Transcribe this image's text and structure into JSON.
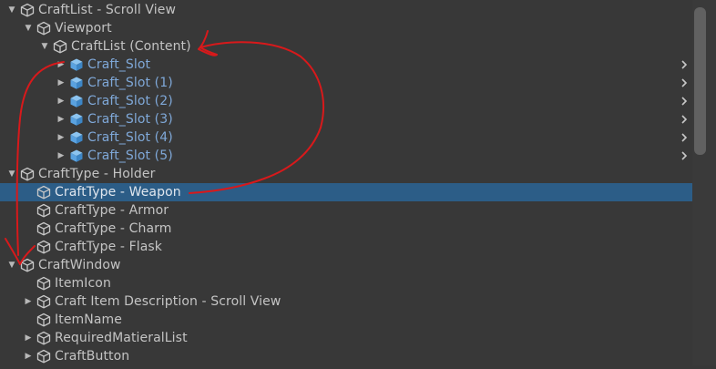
{
  "rows": [
    {
      "label": "CraftList - Scroll View",
      "arrow": "down",
      "kind": "go",
      "selected": false,
      "child_arrow": false
    },
    {
      "label": "Viewport",
      "arrow": "down",
      "kind": "go",
      "selected": false,
      "child_arrow": false
    },
    {
      "label": "CraftList (Content)",
      "arrow": "down",
      "kind": "go",
      "selected": false,
      "child_arrow": false
    },
    {
      "label": "Craft_Slot",
      "arrow": "right",
      "kind": "prefab",
      "selected": false,
      "child_arrow": true
    },
    {
      "label": "Craft_Slot (1)",
      "arrow": "right",
      "kind": "prefab",
      "selected": false,
      "child_arrow": true
    },
    {
      "label": "Craft_Slot (2)",
      "arrow": "right",
      "kind": "prefab",
      "selected": false,
      "child_arrow": true
    },
    {
      "label": "Craft_Slot (3)",
      "arrow": "right",
      "kind": "prefab",
      "selected": false,
      "child_arrow": true
    },
    {
      "label": "Craft_Slot (4)",
      "arrow": "right",
      "kind": "prefab",
      "selected": false,
      "child_arrow": true
    },
    {
      "label": "Craft_Slot (5)",
      "arrow": "right",
      "kind": "prefab",
      "selected": false,
      "child_arrow": true
    },
    {
      "label": "CraftType - Holder",
      "arrow": "down",
      "kind": "go",
      "selected": false,
      "child_arrow": false
    },
    {
      "label": "CraftType - Weapon",
      "arrow": "none",
      "kind": "go",
      "selected": true,
      "child_arrow": false
    },
    {
      "label": "CraftType - Armor",
      "arrow": "none",
      "kind": "go",
      "selected": false,
      "child_arrow": false
    },
    {
      "label": "CraftType - Charm",
      "arrow": "none",
      "kind": "go",
      "selected": false,
      "child_arrow": false
    },
    {
      "label": "CraftType - Flask",
      "arrow": "none",
      "kind": "go",
      "selected": false,
      "child_arrow": false
    },
    {
      "label": "CraftWindow",
      "arrow": "down",
      "kind": "go",
      "selected": false,
      "child_arrow": false
    },
    {
      "label": "ItemIcon",
      "arrow": "none",
      "kind": "go",
      "selected": false,
      "child_arrow": false
    },
    {
      "label": "Craft Item Description - Scroll View",
      "arrow": "right",
      "kind": "go",
      "selected": false,
      "child_arrow": false
    },
    {
      "label": "ItemName",
      "arrow": "none",
      "kind": "go",
      "selected": false,
      "child_arrow": false
    },
    {
      "label": "RequiredMatieralList",
      "arrow": "right",
      "kind": "go",
      "selected": false,
      "child_arrow": false
    },
    {
      "label": "CraftButton",
      "arrow": "right",
      "kind": "go",
      "selected": false,
      "child_arrow": false
    }
  ],
  "icons": {
    "gameobject": "gameobject-cube-icon",
    "prefab": "prefab-cube-icon",
    "expand_down": "triangle-down-icon",
    "expand_right": "triangle-right-icon",
    "open_prefab": "chevron-right-icon"
  },
  "colors": {
    "background": "#383838",
    "selection": "#2c5d87",
    "text": "#c4c4c4",
    "prefab_text": "#7fa8d8",
    "prefab_icon": "#5aa2e0",
    "annotation": "#d8191b"
  }
}
